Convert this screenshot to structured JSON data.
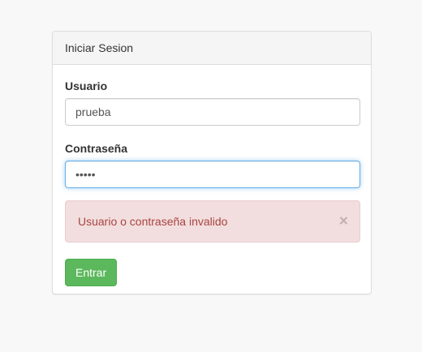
{
  "panel": {
    "title": "Iniciar Sesion"
  },
  "form": {
    "username_label": "Usuario",
    "username_value": "prueba",
    "password_label": "Contraseña",
    "password_value": "•••••",
    "submit_label": "Entrar"
  },
  "alert": {
    "message": "Usuario o contraseña invalido",
    "close_glyph": "×"
  },
  "colors": {
    "alert_bg": "#f2dede",
    "alert_text": "#a94442",
    "button_bg": "#5cb85c",
    "focus_border": "#66afe9"
  }
}
